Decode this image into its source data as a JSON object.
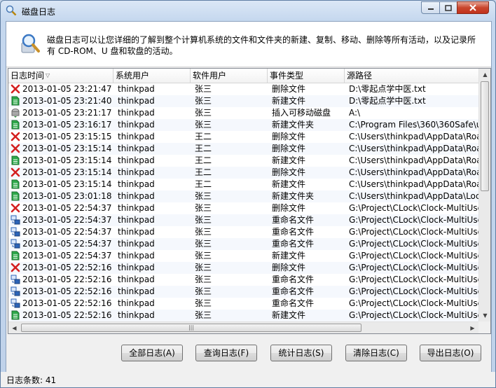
{
  "window": {
    "title": "磁盘日志"
  },
  "banner": {
    "description": "磁盘日志可以让您详细的了解到整个计算机系统的文件和文件夹的新建、复制、移动、删除等所有活动，以及记录所有 CD-ROM、U 盘和软盘的活动。"
  },
  "table": {
    "columns": [
      "日志时间",
      "系统用户",
      "软件用户",
      "事件类型",
      "源路径"
    ],
    "rows": [
      {
        "icon": "delete-icon",
        "time": "2013-01-05 23:21:47",
        "sys_user": "thinkpad",
        "soft_user": "张三",
        "event": "删除文件",
        "path": "D:\\零起点学中医.txt"
      },
      {
        "icon": "new-file-icon",
        "time": "2013-01-05 23:21:40",
        "sys_user": "thinkpad",
        "soft_user": "张三",
        "event": "新建文件",
        "path": "D:\\零起点学中医.txt"
      },
      {
        "icon": "removable-disk-icon",
        "time": "2013-01-05 23:21:17",
        "sys_user": "thinkpad",
        "soft_user": "张三",
        "event": "插入可移动磁盘",
        "path": "A:\\"
      },
      {
        "icon": "new-file-icon",
        "time": "2013-01-05 23:16:17",
        "sys_user": "thinkpad",
        "soft_user": "张三",
        "event": "新建文件夹",
        "path": "C:\\Program Files\\360\\360Safe\\u..."
      },
      {
        "icon": "delete-icon",
        "time": "2013-01-05 23:15:15",
        "sys_user": "thinkpad",
        "soft_user": "王二",
        "event": "删除文件",
        "path": "C:\\Users\\thinkpad\\AppData\\Roa..."
      },
      {
        "icon": "delete-icon",
        "time": "2013-01-05 23:15:14",
        "sys_user": "thinkpad",
        "soft_user": "王二",
        "event": "删除文件",
        "path": "C:\\Users\\thinkpad\\AppData\\Roa..."
      },
      {
        "icon": "new-file-icon",
        "time": "2013-01-05 23:15:14",
        "sys_user": "thinkpad",
        "soft_user": "王二",
        "event": "新建文件",
        "path": "C:\\Users\\thinkpad\\AppData\\Roa..."
      },
      {
        "icon": "delete-icon",
        "time": "2013-01-05 23:15:14",
        "sys_user": "thinkpad",
        "soft_user": "王二",
        "event": "删除文件",
        "path": "C:\\Users\\thinkpad\\AppData\\Roa..."
      },
      {
        "icon": "new-file-icon",
        "time": "2013-01-05 23:15:14",
        "sys_user": "thinkpad",
        "soft_user": "王二",
        "event": "新建文件",
        "path": "C:\\Users\\thinkpad\\AppData\\Roa..."
      },
      {
        "icon": "new-file-icon",
        "time": "2013-01-05 23:01:18",
        "sys_user": "thinkpad",
        "soft_user": "张三",
        "event": "新建文件夹",
        "path": "C:\\Users\\thinkpad\\AppData\\Local..."
      },
      {
        "icon": "delete-icon",
        "time": "2013-01-05 22:54:37",
        "sys_user": "thinkpad",
        "soft_user": "张三",
        "event": "删除文件",
        "path": "G:\\Project\\CLock\\Clock-MultiUse..."
      },
      {
        "icon": "rename-icon",
        "time": "2013-01-05 22:54:37",
        "sys_user": "thinkpad",
        "soft_user": "张三",
        "event": "重命名文件",
        "path": "G:\\Project\\CLock\\Clock-MultiUse..."
      },
      {
        "icon": "rename-icon",
        "time": "2013-01-05 22:54:37",
        "sys_user": "thinkpad",
        "soft_user": "张三",
        "event": "重命名文件",
        "path": "G:\\Project\\CLock\\Clock-MultiUse..."
      },
      {
        "icon": "rename-icon",
        "time": "2013-01-05 22:54:37",
        "sys_user": "thinkpad",
        "soft_user": "张三",
        "event": "重命名文件",
        "path": "G:\\Project\\CLock\\Clock-MultiUse..."
      },
      {
        "icon": "new-file-icon",
        "time": "2013-01-05 22:54:37",
        "sys_user": "thinkpad",
        "soft_user": "张三",
        "event": "新建文件",
        "path": "G:\\Project\\CLock\\Clock-MultiUse..."
      },
      {
        "icon": "delete-icon",
        "time": "2013-01-05 22:52:16",
        "sys_user": "thinkpad",
        "soft_user": "张三",
        "event": "删除文件",
        "path": "G:\\Project\\CLock\\Clock-MultiUse..."
      },
      {
        "icon": "rename-icon",
        "time": "2013-01-05 22:52:16",
        "sys_user": "thinkpad",
        "soft_user": "张三",
        "event": "重命名文件",
        "path": "G:\\Project\\CLock\\Clock-MultiUse..."
      },
      {
        "icon": "rename-icon",
        "time": "2013-01-05 22:52:16",
        "sys_user": "thinkpad",
        "soft_user": "张三",
        "event": "重命名文件",
        "path": "G:\\Project\\CLock\\Clock-MultiUse..."
      },
      {
        "icon": "rename-icon",
        "time": "2013-01-05 22:52:16",
        "sys_user": "thinkpad",
        "soft_user": "张三",
        "event": "重命名文件",
        "path": "G:\\Project\\CLock\\Clock-MultiUse..."
      },
      {
        "icon": "new-file-icon",
        "time": "2013-01-05 22:52:16",
        "sys_user": "thinkpad",
        "soft_user": "张三",
        "event": "新建文件",
        "path": "G:\\Project\\CLock\\Clock-MultiUse..."
      }
    ]
  },
  "buttons": {
    "all_logs": "全部日志(A)",
    "query_logs": "查询日志(F)",
    "stats_logs": "统计日志(S)",
    "clear_logs": "清除日志(C)",
    "export_logs": "导出日志(O)"
  },
  "status": {
    "count_text": "日志条数: 41"
  },
  "colors": {
    "delete": "#d42020",
    "new_file": "#2ea84a",
    "rename": "#2c64b8"
  }
}
